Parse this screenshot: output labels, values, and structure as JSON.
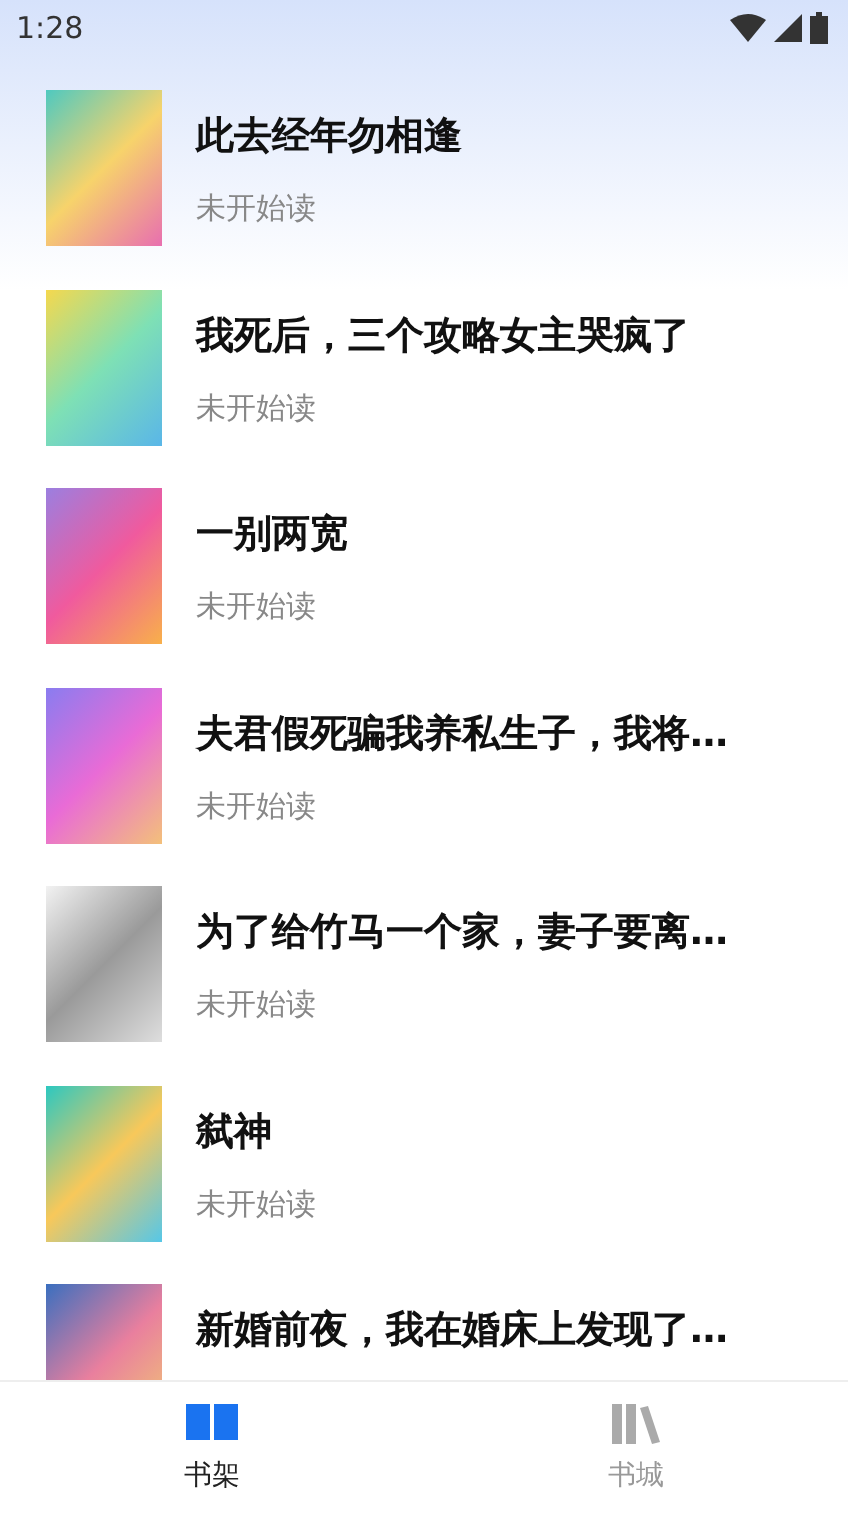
{
  "status_bar": {
    "time": "1:28"
  },
  "books": [
    {
      "title": "此去经年勿相逢",
      "progress": "未开始读"
    },
    {
      "title": "我死后，三个攻略女主哭疯了",
      "progress": "未开始读"
    },
    {
      "title": "一别两宽",
      "progress": "未开始读"
    },
    {
      "title": "夫君假死骗我养私生子，我将…",
      "progress": "未开始读"
    },
    {
      "title": "为了给竹马一个家，妻子要离…",
      "progress": "未开始读"
    },
    {
      "title": "弑神",
      "progress": "未开始读"
    },
    {
      "title": "新婚前夜，我在婚床上发现了…"
    }
  ],
  "bottom_nav": [
    {
      "label": "书架",
      "kind": "bookshelf",
      "selected": true
    },
    {
      "label": "书城",
      "kind": "bookstore",
      "selected": false
    }
  ]
}
